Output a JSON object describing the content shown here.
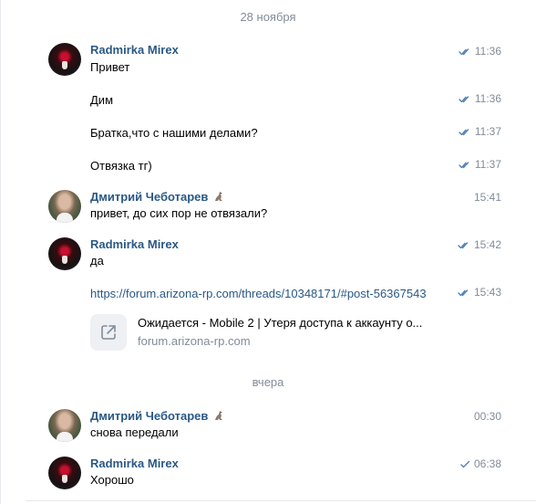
{
  "dates": {
    "first": "28 ноября",
    "second": "вчера"
  },
  "messages": {
    "m1": {
      "author": "Radmirka Mirex",
      "text": "Привет",
      "time": "11:36"
    },
    "m2": {
      "text": "Дим",
      "time": "11:36"
    },
    "m3": {
      "text": "Братка,что с нашими делами?",
      "time": "11:37"
    },
    "m4": {
      "text": "Отвязка тг)",
      "time": "11:37"
    },
    "m5": {
      "author": "Дмитрий Чеботарев",
      "text": "привет, до сих пор не отвязали?",
      "time": "15:41"
    },
    "m6": {
      "author": "Radmirka Mirex",
      "text": "да",
      "time": "15:42"
    },
    "m7": {
      "link": "https://forum.arizona-rp.com/threads/10348171/#post-56367543",
      "time": "15:43"
    },
    "snippet": {
      "title": "Ожидается - Mobile 2 | Утеря доступа к аккаунту о...",
      "domain": "forum.arizona-rp.com"
    },
    "m8": {
      "author": "Дмитрий Чеботарев",
      "text": "снова передали",
      "time": "00:30"
    },
    "m9": {
      "author": "Radmirka Mirex",
      "text": "Хорошо",
      "time": "06:38"
    }
  },
  "icons": {
    "read": "double-check-icon",
    "sent": "single-check-icon",
    "external": "external-link-icon",
    "emoji": "kangaroo-emoji-icon"
  },
  "colors": {
    "name": "#2a5885",
    "meta": "#818c99",
    "check": "#5181b8",
    "link": "#2a5885"
  }
}
